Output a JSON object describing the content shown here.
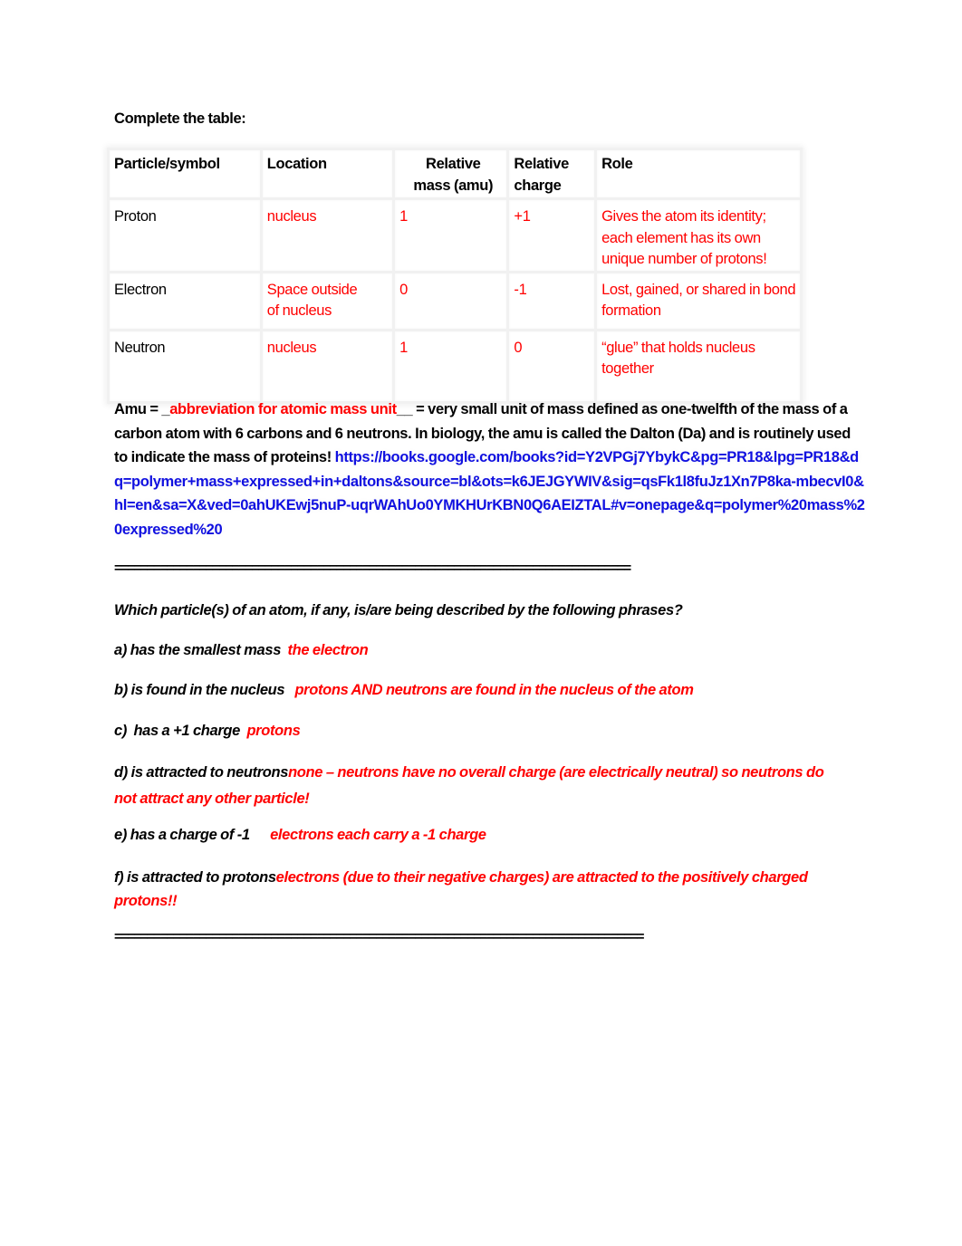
{
  "heading": "Complete the table:",
  "table": {
    "headers": [
      "Particle/symbol",
      "Location",
      "Relative mass  (amu)",
      "Relative charge",
      "Role"
    ],
    "rows": [
      {
        "particle": "Proton",
        "location": "nucleus",
        "mass": "1",
        "charge": "+1",
        "role": "Gives the atom its identity; each element has its own unique number of protons!"
      },
      {
        "particle": "Electron",
        "location": "Space outside of nucleus",
        "mass": "0",
        "charge": "-1",
        "role": "Lost, gained, or shared in bond formation"
      },
      {
        "particle": "Neutron",
        "location": "nucleus",
        "mass": "1",
        "charge": "0",
        "role": "“glue” that holds nucleus together"
      }
    ]
  },
  "amu": {
    "prefix": "Amu = _",
    "answer": "abbreviation for atomic mass unit",
    "suffix": "__ = very small unit of mass defined as one-twelfth of the mass of a carbon atom with 6 carbons and 6 neutrons.  In biology, the amu is called the Dalton (Da) and is routinely used to indicate the mass of proteins! ",
    "link": "https://books.google.com/books?id=Y2VPGj7YbykC&pg=PR18&lpg=PR18&dq=polymer+mass+expressed+in+daltons&source=bl&ots=k6JEJGYWIV&sig=qsFk1l8fuJz1Xn7P8ka-mbecvI0&hl=en&sa=X&ved=0ahUKEwj5nuP-uqrWAhUo0YMKHUrKBN0Q6AEIZTAL#v=onepage&q=polymer%20mass%20expressed%20"
  },
  "separator1": "===============================================================================",
  "separator2": "=================================================================================",
  "questions": {
    "intro": "Which particle(s) of an atom, if any, is/are being described by the following phrases?",
    "items": [
      {
        "label": "a) has the smallest mass  ",
        "answer": "the electron"
      },
      {
        "label": "b) is found in the nucleus   ",
        "answer": "protons AND neutrons are found in the nucleus of the atom"
      },
      {
        "label": "c)  has a +1 charge  ",
        "answer": "protons"
      },
      {
        "label": "d) is attracted to neutrons",
        "answer": "none – neutrons have no overall charge (are electrically neutral) so neutrons do not attract any other particle!"
      },
      {
        "label": "e) has a charge of -1      ",
        "answer": "electrons each carry a -1 charge"
      },
      {
        "label": "f) is attracted to protons",
        "answer": "electrons (due to their negative charges) are attracted to the positively charged protons!!"
      }
    ]
  },
  "colors": {
    "answer": "#ff0000",
    "link": "#1010e0",
    "text": "#000000"
  }
}
